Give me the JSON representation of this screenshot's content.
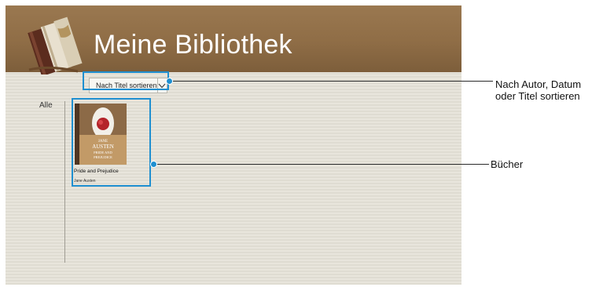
{
  "header": {
    "title": "Meine Bibliothek",
    "logo_icon": "stacked-books-icon"
  },
  "toolbar": {
    "sort_label": "Nach Titel sortieren",
    "sort_arrow_icon": "chevron-down-icon"
  },
  "sidebar": {
    "filter_all": "Alle"
  },
  "books": [
    {
      "title": "Pride and Prejudice",
      "author": "Jane Austen",
      "cover_text_1": "JANE",
      "cover_text_2": "AUSTEN",
      "cover_text_3": "PRIDE AND",
      "cover_text_4": "PREJUDICE"
    }
  ],
  "callouts": {
    "sort_line1": "Nach Autor, Datum",
    "sort_line2": "oder Titel sortieren",
    "books": "Bücher",
    "color": "#1f8fd0"
  },
  "colors": {
    "header_brown": "#8f6d46",
    "background": "#e4e1d8"
  }
}
